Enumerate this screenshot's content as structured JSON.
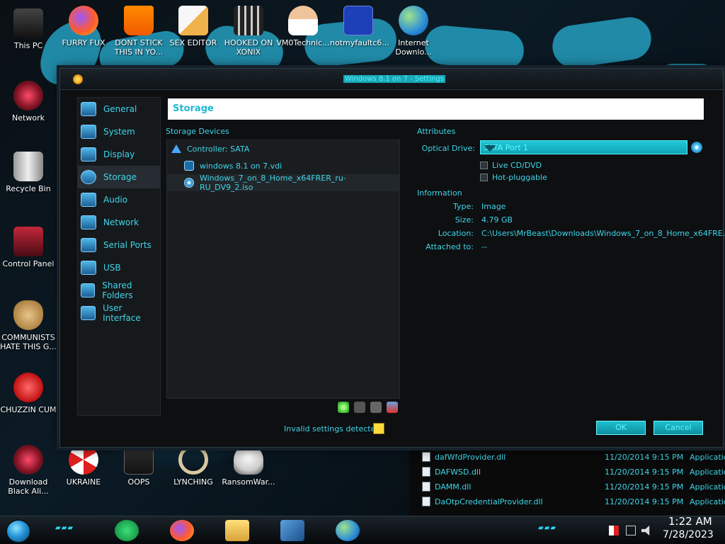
{
  "desktop_icons": [
    {
      "label": "This PC",
      "icon": "computer-icon"
    },
    {
      "label": "FURRY FUX",
      "icon": "firefox-icon"
    },
    {
      "label": "DONT STICK THIS IN YO...",
      "icon": "vlc-icon"
    },
    {
      "label": "SEX EDITOR",
      "icon": "hxd-icon"
    },
    {
      "label": "HOOKED ON XONIX",
      "icon": "game-icon"
    },
    {
      "label": "VM0Technic...",
      "icon": "doctor-icon"
    },
    {
      "label": "notmyfaultc6...",
      "icon": "bsod-icon"
    },
    {
      "label": "Internet Downlo...",
      "icon": "globe-icon"
    },
    {
      "label": "Network",
      "icon": "network-icon"
    },
    {
      "label": "Recycle Bin",
      "icon": "recycle-bin-icon"
    },
    {
      "label": "Control Panel",
      "icon": "control-panel-icon"
    },
    {
      "label": "COMMUNISTS HATE THIS G...",
      "icon": "money-bag-icon"
    },
    {
      "label": "CHUZZIN CUM",
      "icon": "chuzzle-icon"
    },
    {
      "label": "Download Black Ali...",
      "icon": "network-icon"
    },
    {
      "label": "UKRAINE",
      "icon": "radiation-icon"
    },
    {
      "label": "OOPS",
      "icon": "trash-icon"
    },
    {
      "label": "LYNCHING",
      "icon": "rope-icon"
    },
    {
      "label": "RansomWar...",
      "icon": "skull-icon"
    }
  ],
  "window": {
    "title": "Windows 8.1 on 7 - Settings",
    "header": "Storage",
    "sidebar": [
      {
        "label": "General",
        "icon": "monitor-icon"
      },
      {
        "label": "System",
        "icon": "chip-icon"
      },
      {
        "label": "Display",
        "icon": "display-icon"
      },
      {
        "label": "Storage",
        "icon": "disk-icon",
        "active": true
      },
      {
        "label": "Audio",
        "icon": "speaker-icon"
      },
      {
        "label": "Network",
        "icon": "network-adapter-icon"
      },
      {
        "label": "Serial Ports",
        "icon": "serial-port-icon"
      },
      {
        "label": "USB",
        "icon": "usb-icon"
      },
      {
        "label": "Shared Folders",
        "icon": "folder-icon"
      },
      {
        "label": "User Interface",
        "icon": "ui-window-icon"
      }
    ],
    "storage_devices_label": "Storage Devices",
    "tree": {
      "controller": "Controller: SATA",
      "items": [
        {
          "label": "windows 8.1 on 7.vdi",
          "icon": "hard-disk-icon"
        },
        {
          "label": "Windows_7_on_8_Home_x64FRER_ru-RU_DV9_2.iso",
          "icon": "optical-disc-icon"
        }
      ]
    },
    "attributes_label": "Attributes",
    "optical_drive_label": "Optical Drive:",
    "optical_drive_value": "SATA Port 1",
    "live_cd_label": "Live CD/DVD",
    "hot_pluggable_label": "Hot-pluggable",
    "information_label": "Information",
    "info": [
      {
        "key": "Type:",
        "value": "Image"
      },
      {
        "key": "Size:",
        "value": "4.79 GB"
      },
      {
        "key": "Location:",
        "value": "C:\\Users\\MrBeast\\Downloads\\Windows_7_on_8_Home_x64FRE..."
      },
      {
        "key": "Attached to:",
        "value": "--"
      }
    ],
    "invalid_settings": "Invalid settings detected",
    "ok_label": "OK",
    "cancel_label": "Cancel"
  },
  "explorer_files": [
    {
      "name": "dafWfdProvider.dll",
      "date": "11/20/2014 9:15 PM",
      "type": "Applicatio"
    },
    {
      "name": "DAFWSD.dll",
      "date": "11/20/2014 9:15 PM",
      "type": "Applicatio"
    },
    {
      "name": "DAMM.dll",
      "date": "11/20/2014 9:15 PM",
      "type": "Applicatio"
    },
    {
      "name": "DaOtpCredentialProvider.dll",
      "date": "11/20/2014 9:15 PM",
      "type": "Applicatio"
    }
  ],
  "taskbar": {
    "time": "1:22 AM",
    "date": "7/28/2023"
  },
  "colors": {
    "accent": "#3fd5e8",
    "button": "#1ebfcf",
    "window_bg": "#0d0f11"
  }
}
